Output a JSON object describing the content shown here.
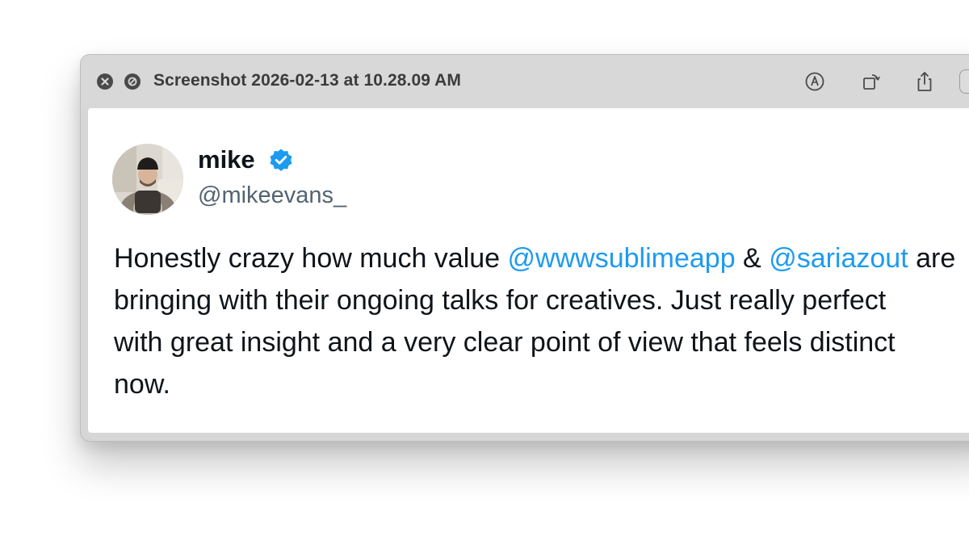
{
  "window": {
    "title": "Screenshot 2026-02-13 at 10.28.09 AM"
  },
  "toolbar": {
    "icons": [
      "close-icon",
      "block-icon",
      "markup-icon",
      "rotate-icon",
      "share-icon",
      "more-icon"
    ]
  },
  "tweet": {
    "author": {
      "display_name": "mike",
      "handle": "@mikeevans_",
      "verified": true
    },
    "lines": [
      {
        "before": "Honestly crazy how much value ",
        "mention1": "@wwwsublimeapp",
        "middle": " & ",
        "mention2": "@sariazout",
        "after": " are"
      },
      {
        "text": "bringing with their ongoing talks for creatives. Just really perfect"
      },
      {
        "text": "with great insight and a very clear point of view that feels distinct"
      },
      {
        "text": "now."
      }
    ]
  },
  "colors": {
    "mention": "#1d9bf0",
    "text": "#0f1419",
    "handle": "#536471",
    "verified_badge": "#1d9bf0",
    "titlebar": "#d8d8d8"
  }
}
